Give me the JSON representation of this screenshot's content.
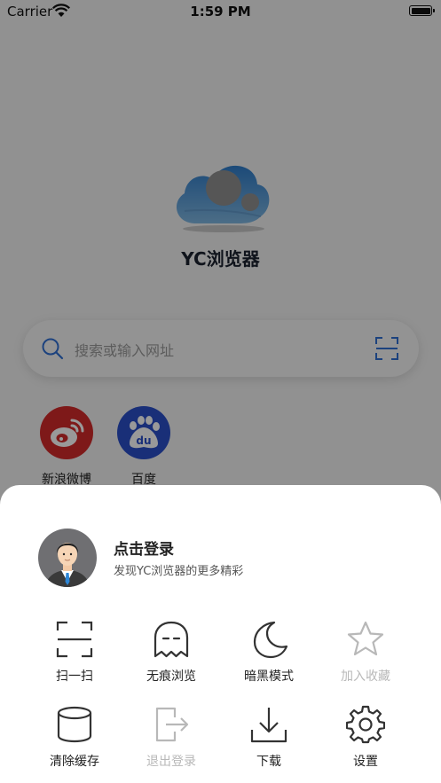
{
  "status_bar": {
    "carrier": "Carrier",
    "time": "1:59 PM"
  },
  "app": {
    "title": "YC浏览器"
  },
  "search": {
    "placeholder": "搜索或输入网址"
  },
  "shortcuts": [
    {
      "label": "新浪微博",
      "icon": "weibo-icon",
      "color": "#d32a2a"
    },
    {
      "label": "百度",
      "icon": "baidu-icon",
      "color": "#2b4fc9"
    }
  ],
  "sheet": {
    "login_title": "点击登录",
    "login_subtitle": "发现YC浏览器的更多精彩",
    "menu": [
      {
        "label": "扫一扫",
        "icon": "scan-icon",
        "enabled": true
      },
      {
        "label": "无痕浏览",
        "icon": "ghost-icon",
        "enabled": true
      },
      {
        "label": "暗黑模式",
        "icon": "moon-icon",
        "enabled": true
      },
      {
        "label": "加入收藏",
        "icon": "star-icon",
        "enabled": false
      },
      {
        "label": "清除缓存",
        "icon": "database-icon",
        "enabled": true
      },
      {
        "label": "退出登录",
        "icon": "logout-icon",
        "enabled": false
      },
      {
        "label": "下载",
        "icon": "download-icon",
        "enabled": true
      },
      {
        "label": "设置",
        "icon": "gear-icon",
        "enabled": true
      }
    ]
  }
}
